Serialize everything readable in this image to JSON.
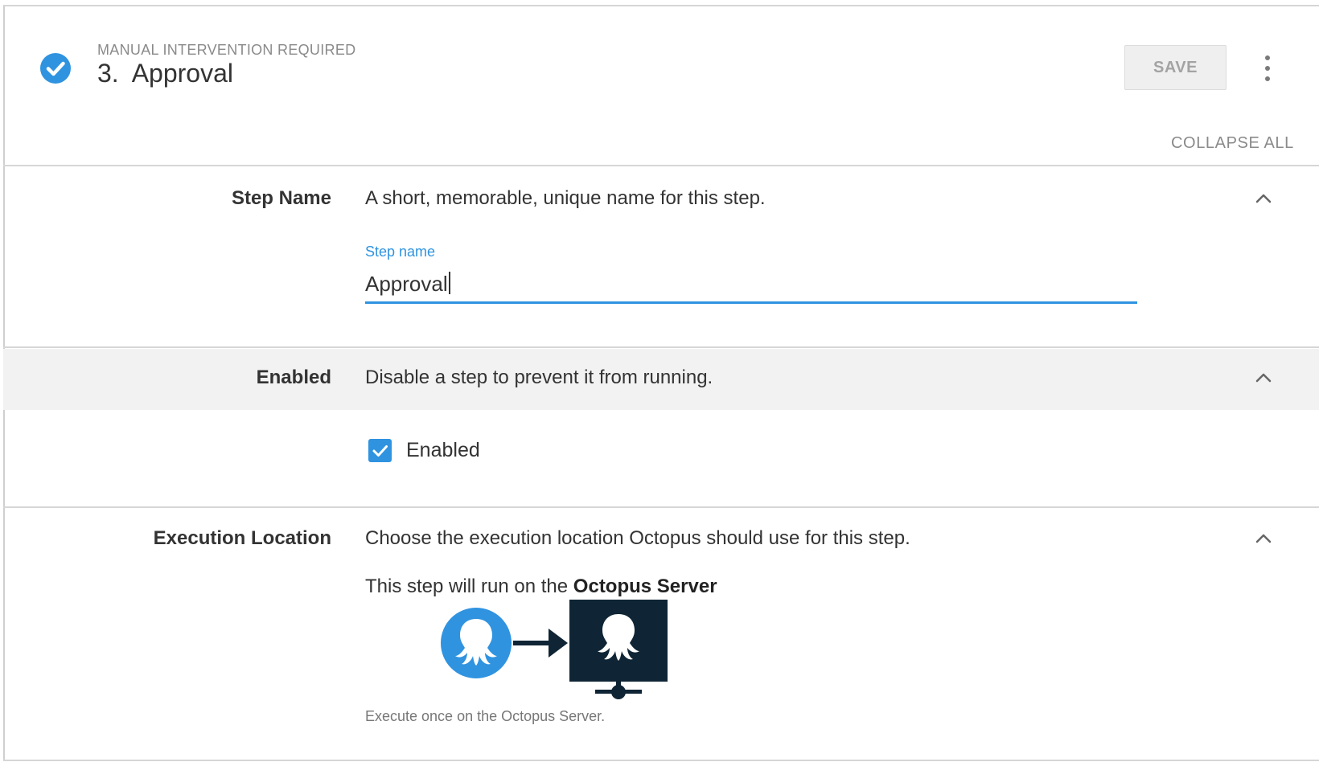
{
  "header": {
    "subtitle": "MANUAL INTERVENTION REQUIRED",
    "title": "3.  Approval",
    "save_label": "SAVE",
    "collapse_all_label": "COLLAPSE ALL",
    "status_icon": "check-circle-icon",
    "more_icon": "more-vertical-icon"
  },
  "sections": {
    "step_name": {
      "label": "Step Name",
      "description": "A short, memorable, unique name for this step.",
      "field_label": "Step name",
      "field_value": "Approval"
    },
    "enabled": {
      "label": "Enabled",
      "description": "Disable a step to prevent it from running.",
      "checkbox_label": "Enabled",
      "checked": true
    },
    "execution_location": {
      "label": "Execution Location",
      "description": "Choose the execution location Octopus should use for this step.",
      "run_prefix": "This step will run on the ",
      "run_target": "Octopus Server",
      "caption": "Execute once on the Octopus Server."
    }
  },
  "colors": {
    "accent": "#2f93e0",
    "server_dark": "#0f2535",
    "band": "#f2f2f2",
    "divider": "#d6d6d6"
  }
}
